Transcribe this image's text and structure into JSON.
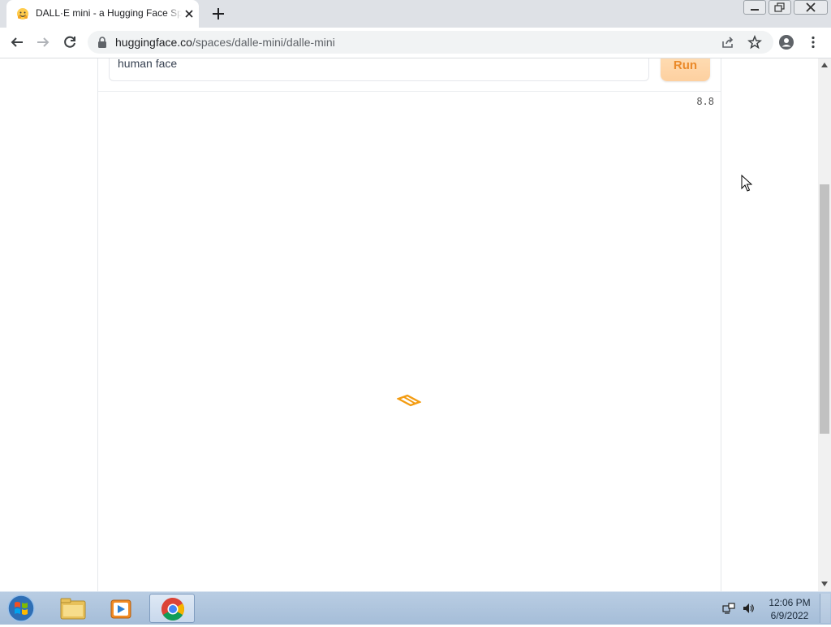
{
  "browser": {
    "tab": {
      "title": "DALL·E mini - a Hugging Face Sp",
      "favicon": "hugging-face-icon"
    },
    "url": {
      "host": "huggingface.co",
      "path": "/spaces/dalle-mini/dalle-mini"
    }
  },
  "app": {
    "prompt_value": "human face",
    "run_label": "Run",
    "timer": "8.8",
    "accent_color": "#ea8a2a",
    "button_color": "#fdd0a0"
  },
  "taskbar": {
    "time": "12:06 PM",
    "date": "6/9/2022",
    "items": [
      "start-icon",
      "explorer-icon",
      "media-player-icon",
      "chrome-icon"
    ]
  }
}
